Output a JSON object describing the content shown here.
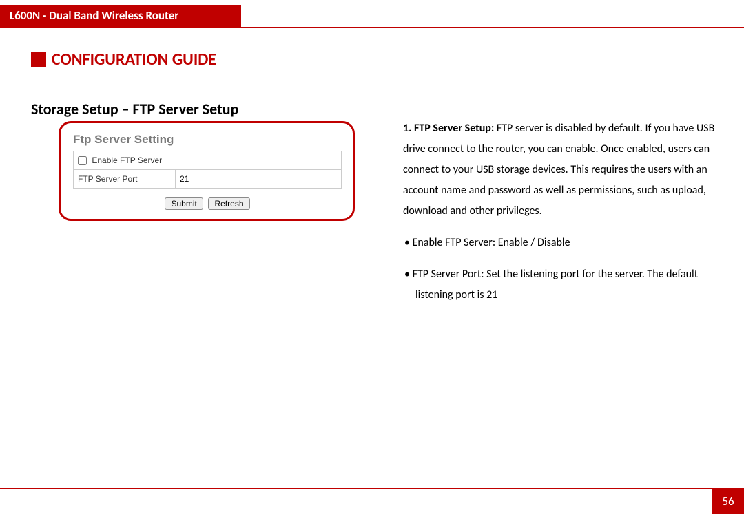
{
  "header": {
    "product": "L600N - Dual Band Wireless Router",
    "guide_title": "CONFIGURATION GUIDE"
  },
  "section": {
    "heading": "Storage Setup – FTP Server Setup"
  },
  "ftp_panel": {
    "title": "Ftp Server Setting",
    "enable_label": "Enable FTP Server",
    "enable_checked": false,
    "port_label": "FTP Server Port",
    "port_value": "21",
    "submit_label": "Submit",
    "refresh_label": "Refresh"
  },
  "description": {
    "item1_num": "1.",
    "item1_label": "FTP Server Setup:",
    "item1_body": " FTP server is disabled by default. If you have USB drive connect to the router, you can enable. Once enabled, users can connect to your USB storage devices. This requires the users with an account name and password as well as permissions, such as upload, download and other privileges.",
    "bullet1_label": "Enable FTP Server:",
    "bullet1_body": " Enable / Disable",
    "bullet2_label": "FTP Server Port:",
    "bullet2_body": " Set the listening port for the server. The default listening port is 21"
  },
  "footer": {
    "page_number": "56"
  }
}
